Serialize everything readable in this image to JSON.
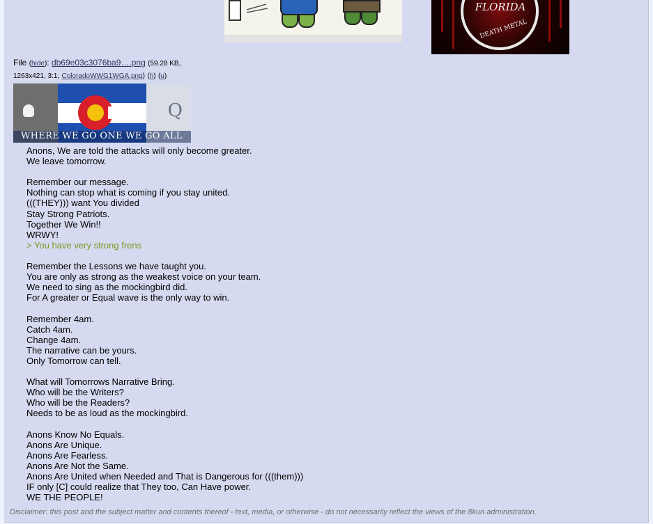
{
  "file": {
    "label": "File",
    "hide_link": "hide",
    "filename": "db69e03c3076ba9….png",
    "size": "59.28 KB,",
    "dims": "1263x421, 3:1,",
    "original_name": "ColoradoWWG1WGA.png",
    "h_link": "h",
    "u_link": "u"
  },
  "image": {
    "banner_text": "WHERE WE GO ONE WE GO ALL",
    "q_letter": "Q"
  },
  "top_logo": {
    "text_top": "FLORIDA",
    "text_mid": "DEATH METAL"
  },
  "body_lines": [
    {
      "text": "Anons, We are told the attacks will only become greater."
    },
    {
      "text": "We leave tomorrow."
    },
    {
      "text": ""
    },
    {
      "text": "Remember our message."
    },
    {
      "text": "Nothing can stop what is coming if you stay united."
    },
    {
      "text": "(((THEY))) want You divided"
    },
    {
      "text": "Stay Strong Patriots."
    },
    {
      "text": "Together We Win!!"
    },
    {
      "text": "WRWY!"
    },
    {
      "text": "> You have very strong frens",
      "quote": true
    },
    {
      "text": ""
    },
    {
      "text": "Remember the Lessons we have taught you."
    },
    {
      "text": "You are only as strong as the weakest voice on your team."
    },
    {
      "text": "We need to sing as the mockingbird did."
    },
    {
      "text": "For A greater or Equal wave is the only way to win."
    },
    {
      "text": ""
    },
    {
      "text": "Remember 4am."
    },
    {
      "text": "Catch 4am."
    },
    {
      "text": "Change 4am."
    },
    {
      "text": "The narrative can be yours."
    },
    {
      "text": "Only Tomorrow can tell."
    },
    {
      "text": ""
    },
    {
      "text": "What will Tomorrows Narrative Bring."
    },
    {
      "text": "Who will be the Writers?"
    },
    {
      "text": "Who will be the Readers?"
    },
    {
      "text": "Needs to be as loud as the mockingbird."
    },
    {
      "text": ""
    },
    {
      "text": "Anons Know No Equals."
    },
    {
      "text": "Anons Are Unique."
    },
    {
      "text": "Anons Are Fearless."
    },
    {
      "text": "Anons Are Not the Same."
    },
    {
      "text": "Anons Are United when Needed and That is Dangerous for (((them)))"
    },
    {
      "text": "IF only [C] could realize that They too, Can Have power."
    },
    {
      "text": "WE THE PEOPLE!"
    }
  ],
  "disclaimer": "Disclaimer: this post and the subject matter and contents thereof - text, media, or otherwise - do not necessarily reflect the views of the 8kun administration.",
  "colors": {
    "post_bg": "#d6daf0",
    "page_bg": "#eef2ff",
    "quote": "#789922",
    "link": "#34345c"
  }
}
